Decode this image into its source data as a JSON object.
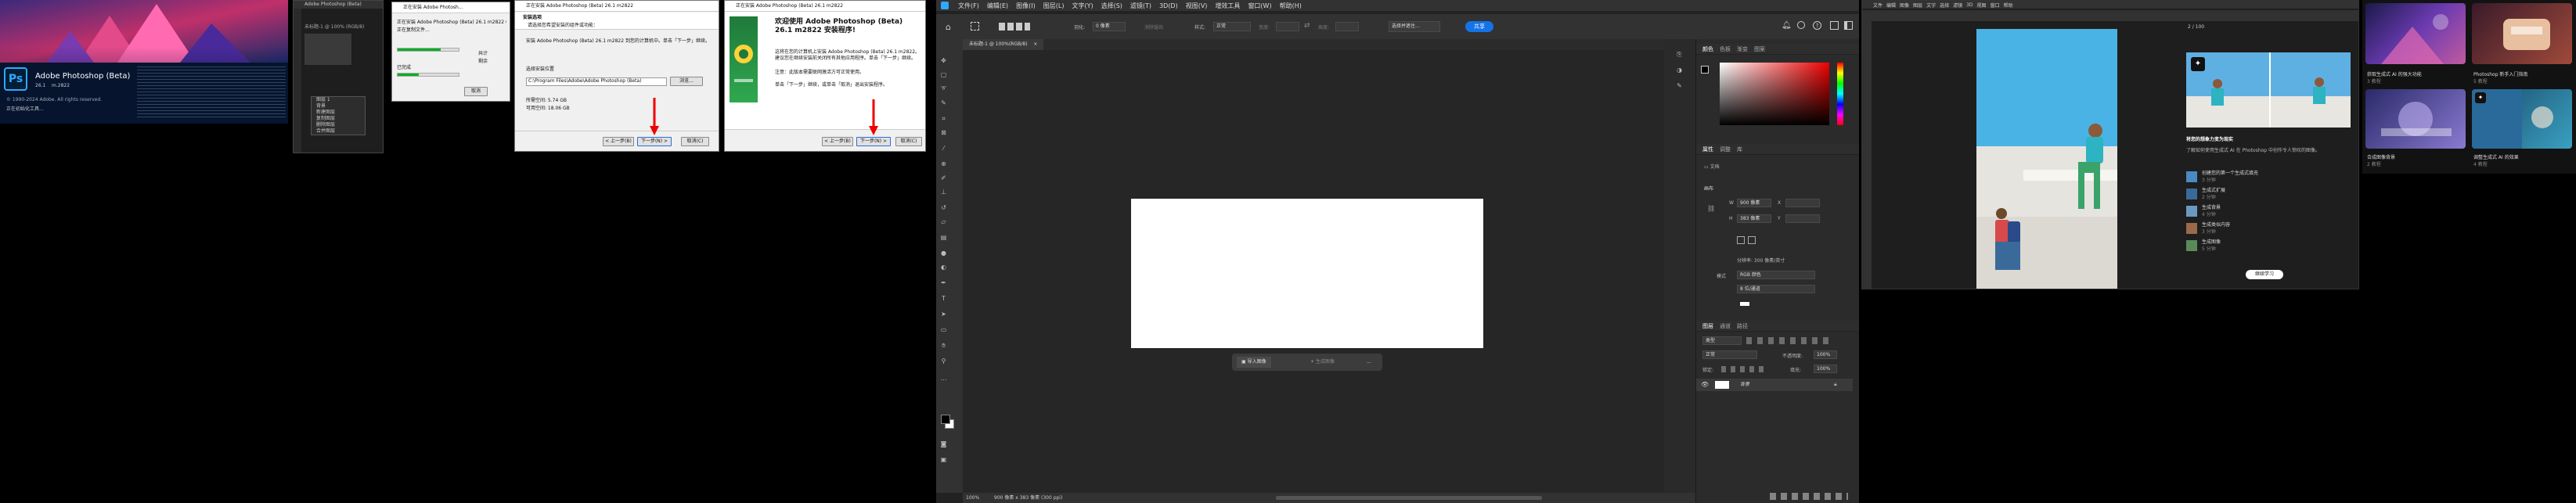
{
  "splash": {
    "title": "Adobe Photoshop (Beta)",
    "version": "26.1",
    "build": "m.2822",
    "copyright": "© 1990-2024 Adobe. All rights reserved.",
    "status": "正在初始化工具...",
    "logo_text": "Ps"
  },
  "installer_progress": {
    "title": "正在安装 Adobe Photosh...",
    "line1": "正在安装 Adobe Photoshop (Beta) 26.1 m2822 (这可能需要几分钟)",
    "line2": "正在复制文件...",
    "line3": "已完成",
    "pct1": 0.7,
    "pct2": 0.35,
    "col_a": "共计",
    "col_b": "剩余",
    "cancel": "取消"
  },
  "setup_dialog1": {
    "title": "正在安装 Adobe Photoshop (Beta) 26.1 m2822",
    "heading": "安装选项",
    "line1": "请选择您希望安装的组件或功能：",
    "line2": "安装 Adobe Photoshop (Beta) 26.1 m2822 到您的计算机中。单击「下一步」继续。",
    "line3": "选择安装位置",
    "path": "C:\\Program Files\\Adobe\\Adobe Photoshop (Beta)",
    "browse": "浏览...",
    "space_req": "所需空间: 5.74 GB",
    "space_avail": "可用空间: 18.06 GB",
    "back": "< 上一步(B)",
    "next": "下一步(N) >",
    "cancel": "取消(C)"
  },
  "setup_dialog2": {
    "title": "正在安装 Adobe Photoshop (Beta) 26.1 m2822",
    "heading": "欢迎使用 Adobe Photoshop (Beta) 26.1 m2822 安装程序!",
    "line1": "这将在您的计算机上安装 Adobe Photoshop (Beta) 26.1 m2822。建议您在继续安装前关闭所有其他应用程序。单击「下一步」继续。",
    "line2": "注意：此版本需要联网激活方可正常使用。",
    "line3": "单击「下一步」继续，或单击「取消」退出安装程序。",
    "back": "< 上一步(B)",
    "next": "下一步(N) >",
    "cancel": "取消(C)"
  },
  "ps_main": {
    "menu": [
      "文件(F)",
      "编辑(E)",
      "图像(I)",
      "图层(L)",
      "文字(Y)",
      "选择(S)",
      "滤镜(T)",
      "3D(D)",
      "视图(V)",
      "增效工具",
      "窗口(W)",
      "帮助(H)"
    ],
    "options": {
      "feather": "羽化:",
      "feather_val": "0 像素",
      "aa": "消除锯齿",
      "style": "样式:",
      "style_val": "正常",
      "width": "宽度:",
      "height": "高度:",
      "select_mask": "选择并遮住...",
      "share": "共享"
    },
    "doc_tab": "未标题-1 @ 100%(RGB/8)",
    "close": "×",
    "taskbar": {
      "import": "导入图像",
      "gen": "生成图像",
      "more": "..."
    },
    "status": {
      "zoom": "100%",
      "dims": "900 像素 x 383 像素 (300 ppi)"
    },
    "color_tabs": [
      "颜色",
      "色板",
      "渐变",
      "图案"
    ],
    "prop_tabs": [
      "属性",
      "调整",
      "库"
    ],
    "prop": {
      "doc": "文档",
      "canvas": "画布",
      "w_label": "W",
      "w_val": "900 像素",
      "h_label": "H",
      "h_val": "383 像素",
      "x_label": "X",
      "y_label": "Y",
      "res": "分辨率: 300 像素/英寸",
      "mode_label": "模式",
      "mode_val": "RGB 颜色",
      "depth_val": "8 位/通道"
    },
    "layer_tabs": [
      "图层",
      "通道",
      "路径"
    ],
    "layers": {
      "search": "类型",
      "blend": "正常",
      "opacity_label": "不透明度:",
      "opacity": "100%",
      "lock": "锁定:",
      "fill_label": "填充:",
      "fill": "100%",
      "bg_name": "背景"
    }
  },
  "ps_small": {
    "title": "Adobe Photoshop (Beta)",
    "doc": "未标题-1 @ 100% (RGB/8)",
    "menu_items": [
      "图层 1",
      "背景",
      "新建图层",
      "复制图层",
      "删除图层",
      "合并图层"
    ]
  },
  "ps_right": {
    "menu": [
      "文件",
      "编辑",
      "图像",
      "图层",
      "文字",
      "选择",
      "滤镜",
      "3D",
      "视图",
      "窗口",
      "帮助"
    ],
    "panel_title": "2 / 100",
    "heading": "将您的想象力变为现实",
    "sub": "了解如何使用生成式 AI 在 Photoshop 中创作令人惊叹的图像。",
    "list": [
      {
        "t": "创建您的第一个生成式填充",
        "s": "3 分钟"
      },
      {
        "t": "生成式扩展",
        "s": "2 分钟"
      },
      {
        "t": "生成背景",
        "s": "4 分钟"
      },
      {
        "t": "生成类似内容",
        "s": "3 分钟"
      },
      {
        "t": "生成图像",
        "s": "5 分钟"
      }
    ],
    "button": "继续学习"
  },
  "gallery": {
    "cards": [
      {
        "t": "获取生成式 AI 的强大功能",
        "s": "3 教程"
      },
      {
        "t": "Photoshop 新手入门指南",
        "s": "5 教程"
      },
      {
        "t": "合成图像背景",
        "s": "2 教程"
      },
      {
        "t": "调整生成式 AI 的效果",
        "s": "4 教程"
      }
    ]
  }
}
